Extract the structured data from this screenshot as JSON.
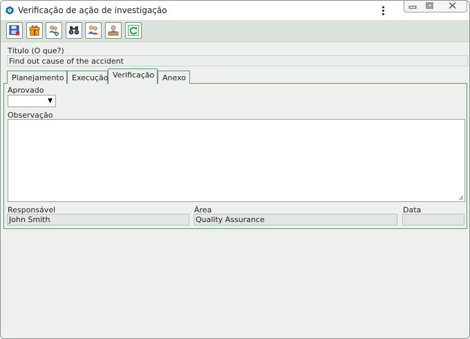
{
  "window": {
    "title": "Verificação de ação de investigação",
    "icon": "app-logo-icon"
  },
  "window_controls": [
    "minimize-icon",
    "restore-icon",
    "close-icon"
  ],
  "toolbar": {
    "buttons": [
      {
        "name": "save-exit-button",
        "icon": "floppy-close-icon"
      },
      {
        "name": "gift-button",
        "icon": "gift-icon"
      },
      {
        "name": "users-config-button",
        "icon": "users-gear-icon"
      },
      {
        "name": "search-button",
        "icon": "binoculars-icon"
      },
      {
        "name": "users-button",
        "icon": "users-icon"
      },
      {
        "name": "user-record-button",
        "icon": "user-record-icon"
      },
      {
        "name": "refresh-button",
        "icon": "refresh-icon"
      }
    ]
  },
  "form": {
    "titulo_label": "Título (O que?)",
    "titulo_value": "Find out cause of the accident"
  },
  "tabs": [
    {
      "label": "Planejamento",
      "active": false
    },
    {
      "label": "Execução",
      "active": false
    },
    {
      "label": "Verificação",
      "active": true
    },
    {
      "label": "Anexo",
      "active": false
    }
  ],
  "verificacao": {
    "aprovado_label": "Aprovado",
    "aprovado_value": "",
    "observacao_label": "Observação",
    "observacao_value": "",
    "responsavel_label": "Responsável",
    "responsavel_value": "John Smith",
    "area_label": "Área",
    "area_value": "Quality Assurance",
    "data_label": "Data",
    "data_value": ""
  },
  "colors": {
    "toolbar_bg": "#d9e3dc",
    "tab_border": "#5a9a74",
    "window_bg": "#eef0ee"
  }
}
